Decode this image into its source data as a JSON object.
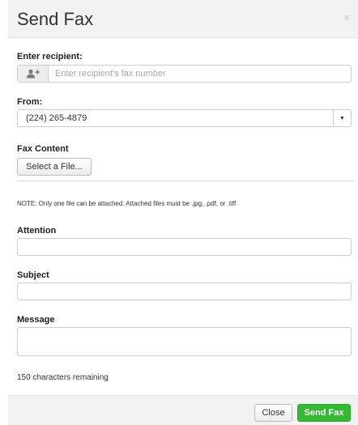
{
  "header": {
    "title": "Send Fax",
    "close_symbol": "×"
  },
  "recipient": {
    "label": "Enter recipient:",
    "placeholder": "Enter recipient's fax number",
    "value": "",
    "addon_icon": "add-contact-icon"
  },
  "from": {
    "label": "From:",
    "selected": "(224) 265-4879",
    "arrow_icon": "caret-down-icon"
  },
  "fax_content": {
    "label": "Fax Content",
    "button_label": "Select a File..."
  },
  "note": "NOTE: Only one file can be attached. Attached files must be .jpg, .pdf, or .tiff",
  "attention": {
    "label": "Attention",
    "value": ""
  },
  "subject": {
    "label": "Subject",
    "value": ""
  },
  "message": {
    "label": "Message",
    "value": ""
  },
  "remaining": "150 characters remaining",
  "footer": {
    "close_label": "Close",
    "send_label": "Send Fax"
  },
  "colors": {
    "header_bg": "#f2f2f2",
    "send_button": "#35b935",
    "border": "#cccccc"
  }
}
